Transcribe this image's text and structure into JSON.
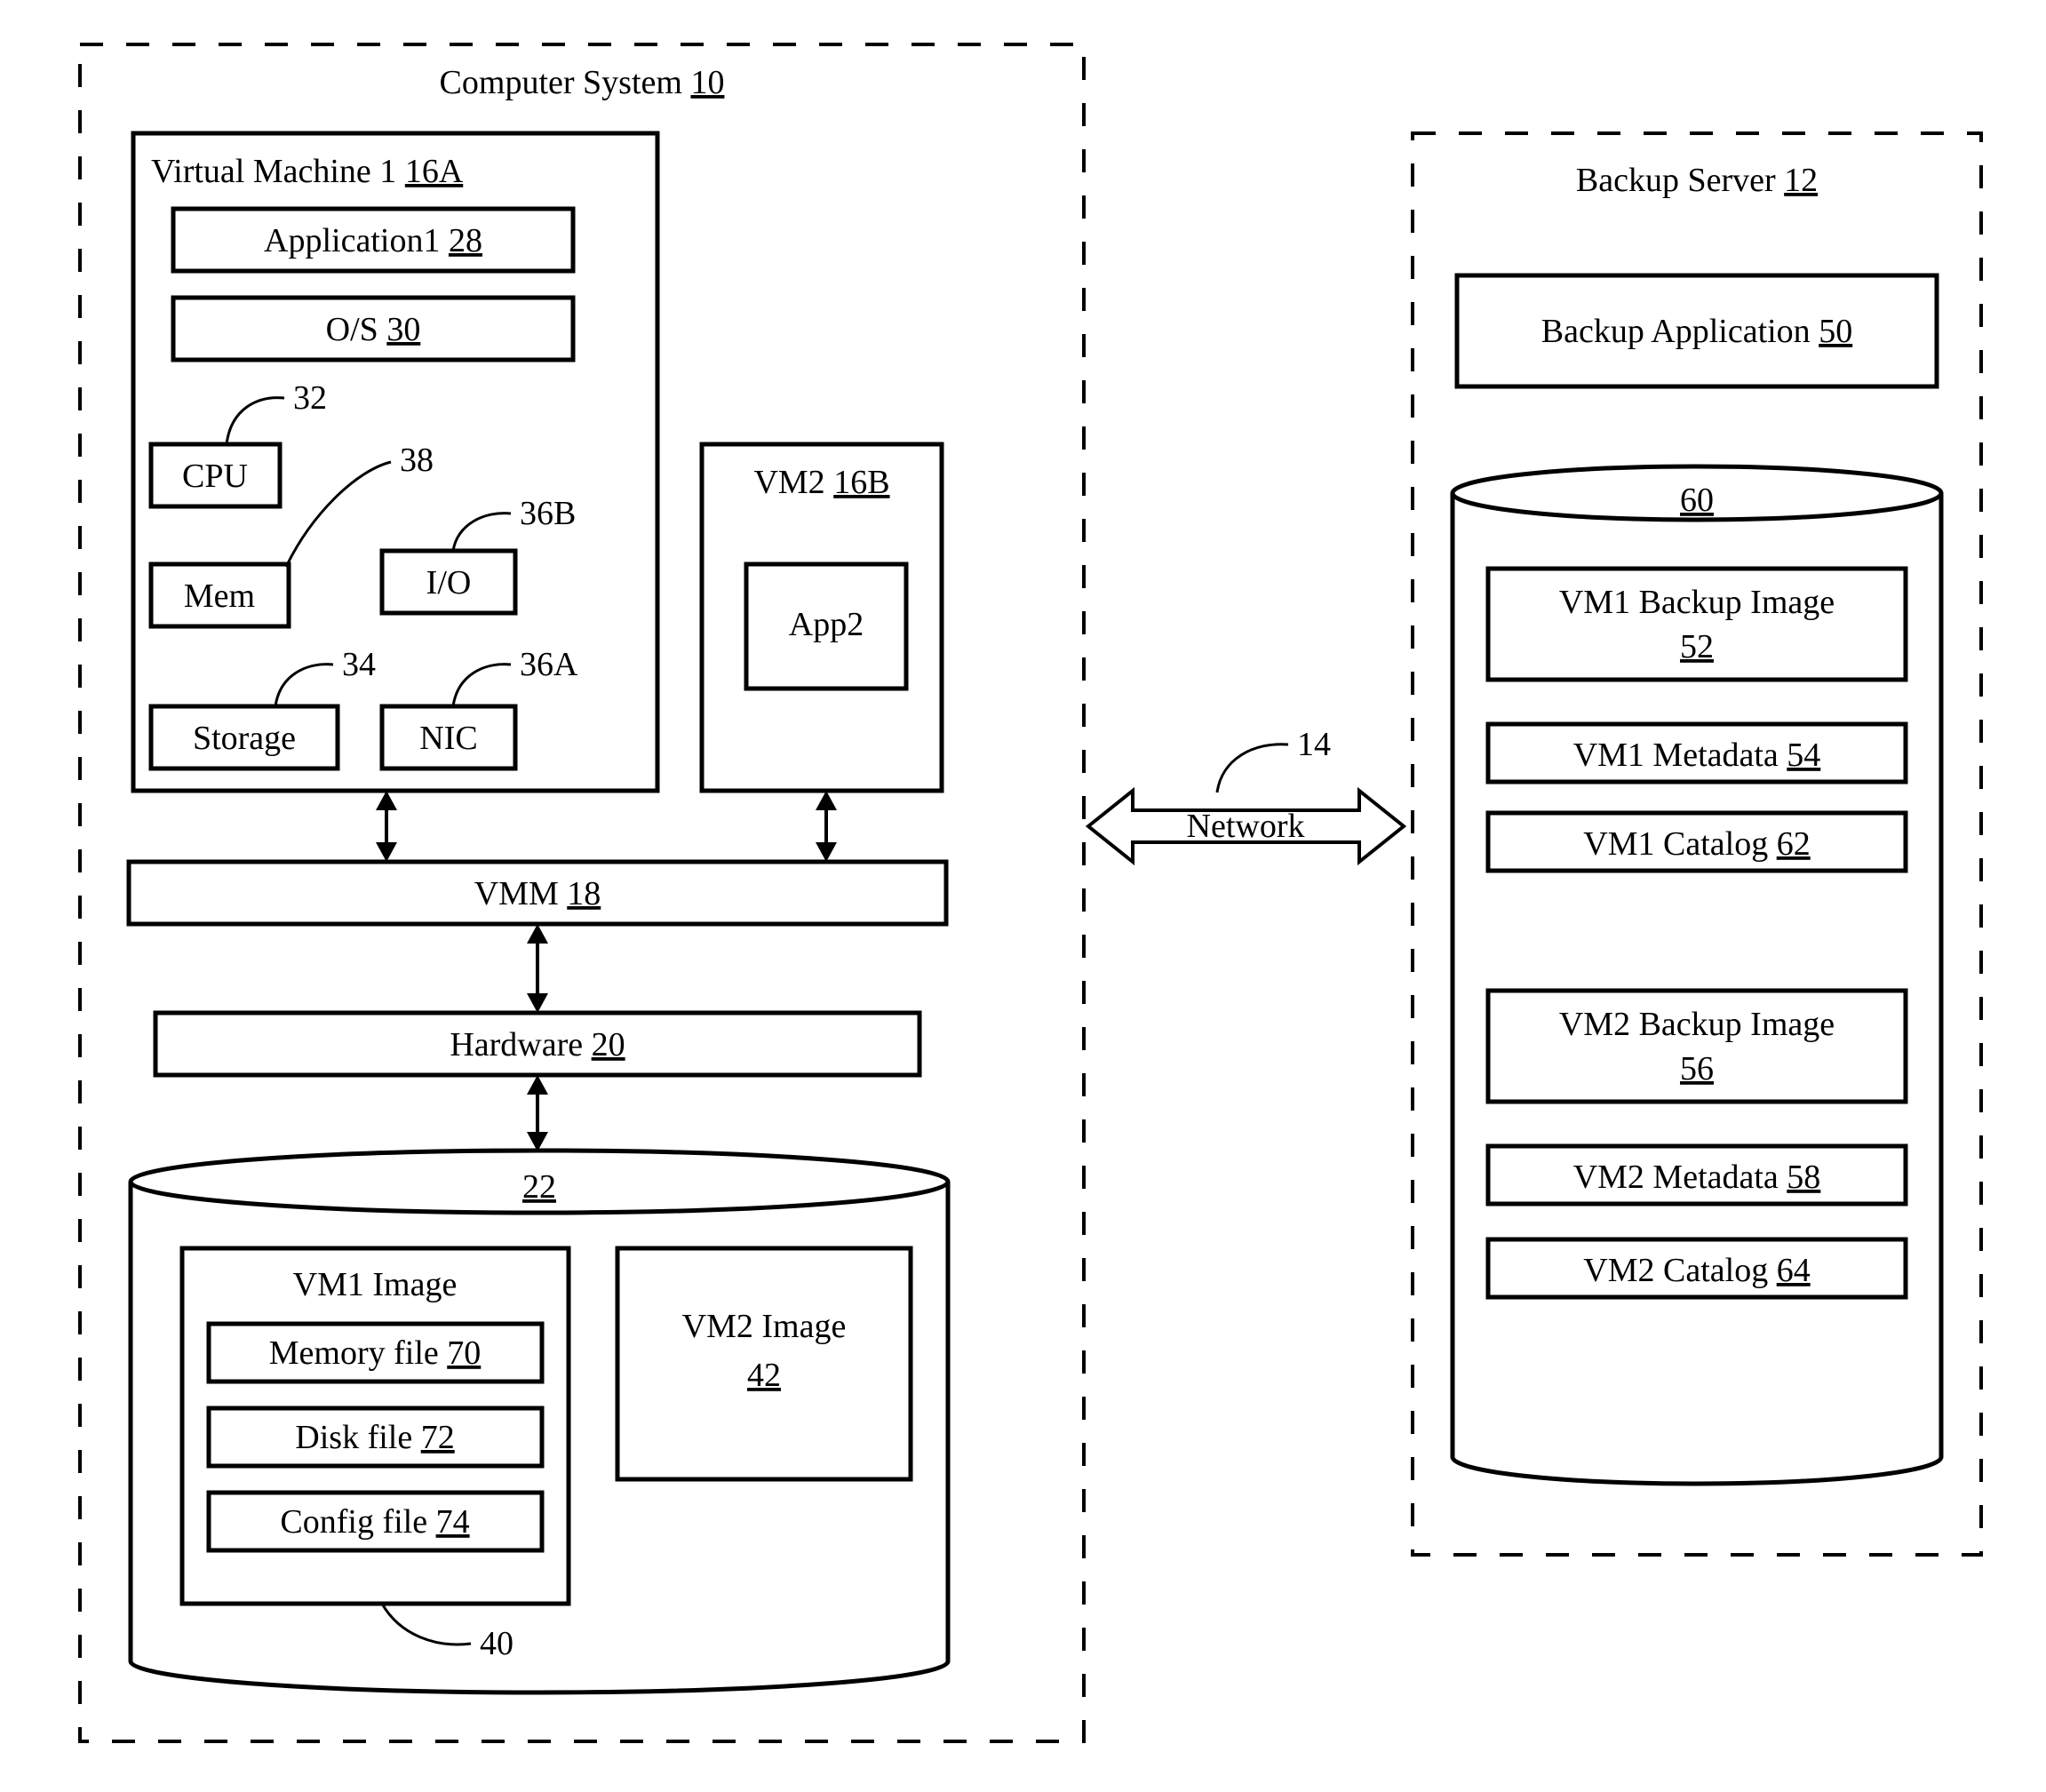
{
  "cs": {
    "title_pre": "Computer System ",
    "title_ref": "10",
    "vm1": {
      "title_pre": "Virtual Machine 1 ",
      "title_ref": "16A",
      "app_pre": "Application1 ",
      "app_ref": "28",
      "os_pre": "O/S ",
      "os_ref": "30",
      "cpu": "CPU",
      "cpu_ref": "32",
      "mem": "Mem",
      "mem_ref": "38",
      "io": "I/O",
      "io_ref": "36B",
      "storage": "Storage",
      "storage_ref": "34",
      "nic": "NIC",
      "nic_ref": "36A"
    },
    "vm2": {
      "title_pre": "VM2 ",
      "title_ref": "16B",
      "app": "App2"
    },
    "vmm_pre": "VMM ",
    "vmm_ref": "18",
    "hw_pre": "Hardware ",
    "hw_ref": "20",
    "storage_cyl": {
      "ref": "22",
      "vm1img_title": "VM1 Image",
      "memfile_pre": "Memory file ",
      "memfile_ref": "70",
      "diskfile_pre": "Disk file ",
      "diskfile_ref": "72",
      "cfgfile_pre": "Config file ",
      "cfgfile_ref": "74",
      "vm1img_ref": "40",
      "vm2img_title": "VM2 Image",
      "vm2img_ref": "42"
    }
  },
  "network": {
    "label": "Network",
    "ref": "14"
  },
  "bs": {
    "title_pre": "Backup Server ",
    "title_ref": "12",
    "app_pre": "Backup Application ",
    "app_ref": "50",
    "cyl_ref": "60",
    "vm1_backup_pre": "VM1 Backup Image",
    "vm1_backup_ref": "52",
    "vm1_meta_pre": "VM1 Metadata ",
    "vm1_meta_ref": "54",
    "vm1_cat_pre": "VM1 Catalog ",
    "vm1_cat_ref": "62",
    "vm2_backup_pre": "VM2 Backup Image",
    "vm2_backup_ref": "56",
    "vm2_meta_pre": "VM2 Metadata ",
    "vm2_meta_ref": "58",
    "vm2_cat_pre": "VM2 Catalog ",
    "vm2_cat_ref": "64"
  }
}
